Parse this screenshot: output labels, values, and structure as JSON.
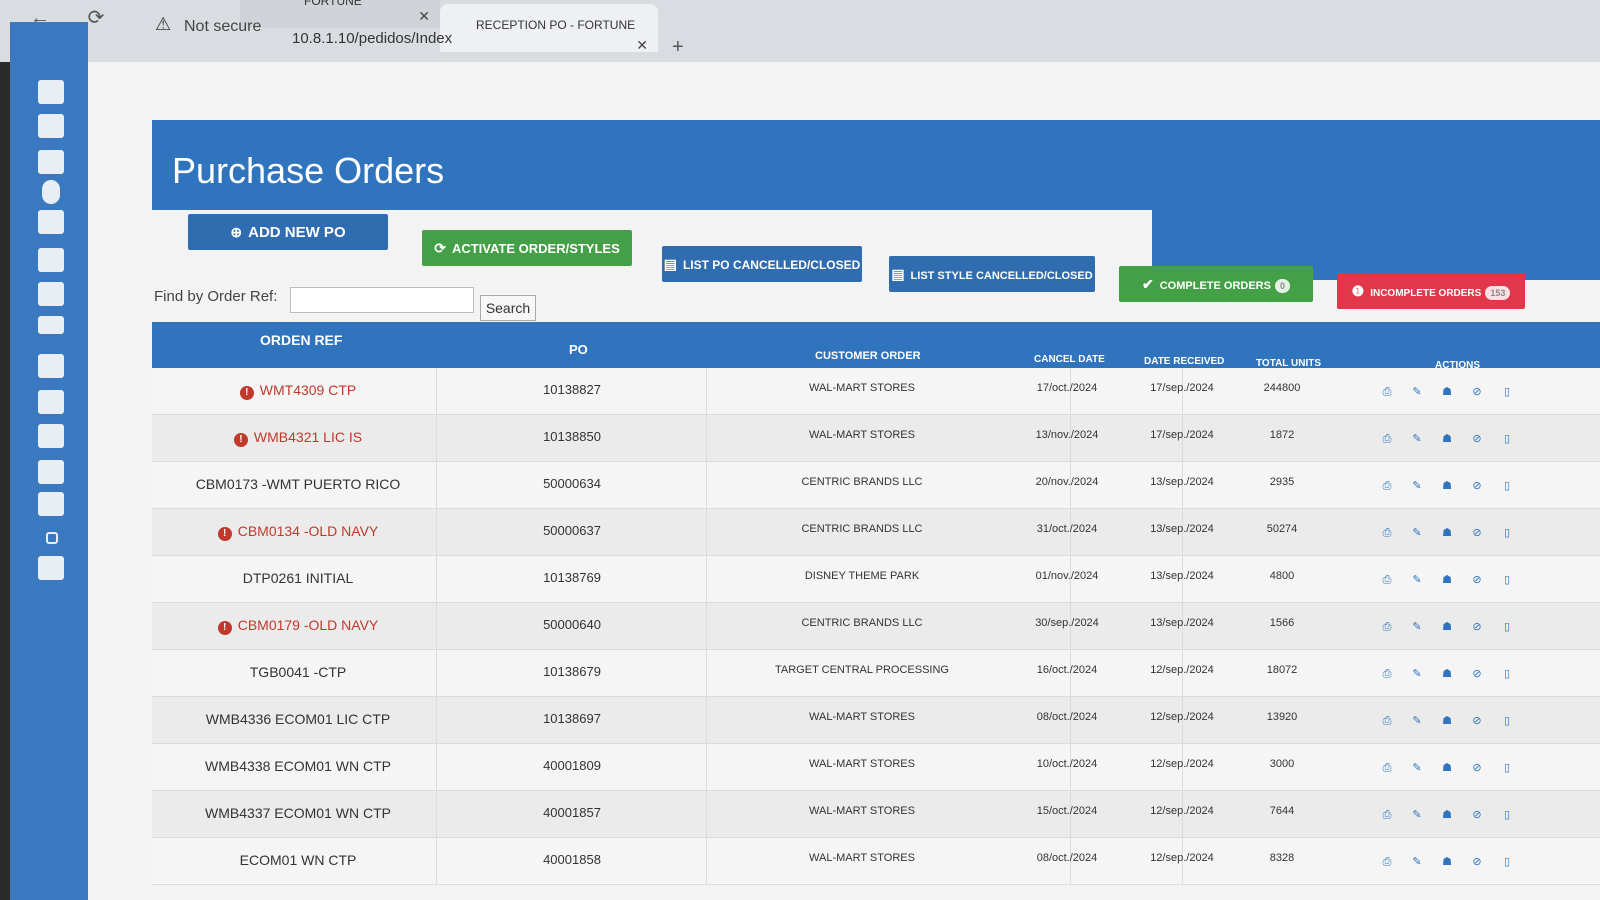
{
  "browser": {
    "tabs": [
      {
        "label": "FORTUNE",
        "close": "✕"
      },
      {
        "label": "RECEPTION PO - FORTUNE",
        "close": "✕"
      }
    ],
    "new_tab": "+",
    "back": "←",
    "reload": "⟳",
    "security_icon": "warning-icon",
    "security_text": "Not secure",
    "url": "10.8.1.10/pedidos/Index"
  },
  "page": {
    "title": "Purchase Orders"
  },
  "toolbar": {
    "add_new_po": "ADD NEW PO",
    "activate_order_styles": "ACTIVATE ORDER/STYLES",
    "list_po_cancelled": "LIST PO CANCELLED/CLOSED",
    "list_style_cancelled": "LIST STYLE CANCELLED/CLOSED",
    "complete_orders": "COMPLETE ORDERS",
    "complete_orders_badge": "0",
    "incomplete_orders": "INCOMPLETE ORDERS",
    "incomplete_orders_badge": "153"
  },
  "search": {
    "label": "Find by Order Ref:",
    "value": "",
    "placeholder": "",
    "button": "Search"
  },
  "table": {
    "columns": {
      "orden_ref": "ORDEN REF",
      "po": "PO",
      "customer_order": "CUSTOMER ORDER",
      "cancel_date": "CANCEL DATE",
      "date_received": "DATE RECEIVED",
      "total_units": "TOTAL UNITS",
      "actions": "ACTIONS"
    },
    "rows": [
      {
        "ref": "WMT4309 CTP",
        "alert": true,
        "po": "10138827",
        "customer": "WAL-MART STORES",
        "cancel": "17/oct./2024",
        "received": "17/sep./2024",
        "units": "244800"
      },
      {
        "ref": "WMB4321 LIC IS",
        "alert": true,
        "po": "10138850",
        "customer": "WAL-MART STORES",
        "cancel": "13/nov./2024",
        "received": "17/sep./2024",
        "units": "1872"
      },
      {
        "ref": "CBM0173 -WMT PUERTO RICO",
        "alert": false,
        "po": "50000634",
        "customer": "CENTRIC BRANDS LLC",
        "cancel": "20/nov./2024",
        "received": "13/sep./2024",
        "units": "2935"
      },
      {
        "ref": "CBM0134 -OLD NAVY",
        "alert": true,
        "po": "50000637",
        "customer": "CENTRIC BRANDS LLC",
        "cancel": "31/oct./2024",
        "received": "13/sep./2024",
        "units": "50274"
      },
      {
        "ref": "DTP0261 INITIAL",
        "alert": false,
        "po": "10138769",
        "customer": "DISNEY THEME PARK",
        "cancel": "01/nov./2024",
        "received": "13/sep./2024",
        "units": "4800"
      },
      {
        "ref": "CBM0179 -OLD NAVY",
        "alert": true,
        "po": "50000640",
        "customer": "CENTRIC BRANDS LLC",
        "cancel": "30/sep./2024",
        "received": "13/sep./2024",
        "units": "1566"
      },
      {
        "ref": "TGB0041 -CTP",
        "alert": false,
        "po": "10138679",
        "customer": "TARGET CENTRAL PROCESSING",
        "cancel": "16/oct./2024",
        "received": "12/sep./2024",
        "units": "18072"
      },
      {
        "ref": "WMB4336 ECOM01 LIC CTP",
        "alert": false,
        "po": "10138697",
        "customer": "WAL-MART STORES",
        "cancel": "08/oct./2024",
        "received": "12/sep./2024",
        "units": "13920"
      },
      {
        "ref": "WMB4338 ECOM01 WN CTP",
        "alert": false,
        "po": "40001809",
        "customer": "WAL-MART STORES",
        "cancel": "10/oct./2024",
        "received": "12/sep./2024",
        "units": "3000"
      },
      {
        "ref": "WMB4337 ECOM01 WN CTP",
        "alert": false,
        "po": "40001857",
        "customer": "WAL-MART STORES",
        "cancel": "15/oct./2024",
        "received": "12/sep./2024",
        "units": "7644"
      },
      {
        "ref": "ECOM01 WN CTP",
        "alert": false,
        "po": "40001858",
        "customer": "WAL-MART STORES",
        "cancel": "08/oct./2024",
        "received": "12/sep./2024",
        "units": "8328"
      }
    ],
    "action_icons": [
      "print-icon",
      "edit-icon",
      "user-icon",
      "cancel-icon",
      "document-icon"
    ]
  },
  "colors": {
    "header_blue": "#2f74bd",
    "button_green": "#43a047",
    "button_red": "#e0384a",
    "alert_red": "#c0392b"
  }
}
